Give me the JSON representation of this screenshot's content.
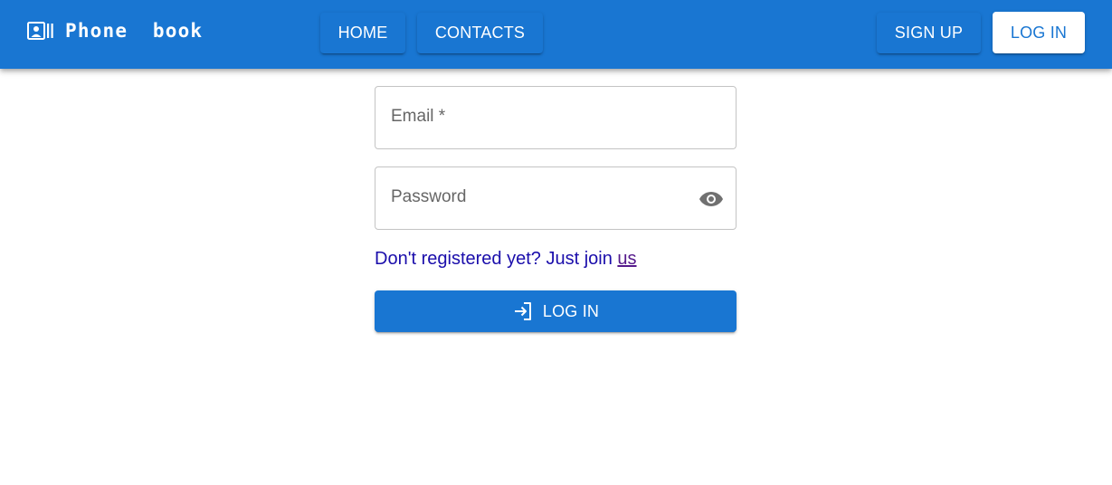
{
  "header": {
    "brand": "Phone  book",
    "brand_icon": "contact-card-icon",
    "nav": {
      "home": "HOME",
      "contacts": "CONTACTS"
    },
    "auth": {
      "signup": "SIGN UP",
      "login": "LOG IN"
    }
  },
  "form": {
    "email": {
      "label": "Email *"
    },
    "password": {
      "label": "Password",
      "toggle_icon": "eye-icon"
    },
    "join": {
      "text": "Don't registered yet? Just join ",
      "link": "us"
    },
    "submit": {
      "label": "LOG IN",
      "icon": "login-arrow-icon"
    }
  },
  "colors": {
    "primary": "#1976d2",
    "white": "#ffffff",
    "label": "#666666",
    "link_text": "#1a0dab",
    "link_visited": "#551a8b"
  }
}
